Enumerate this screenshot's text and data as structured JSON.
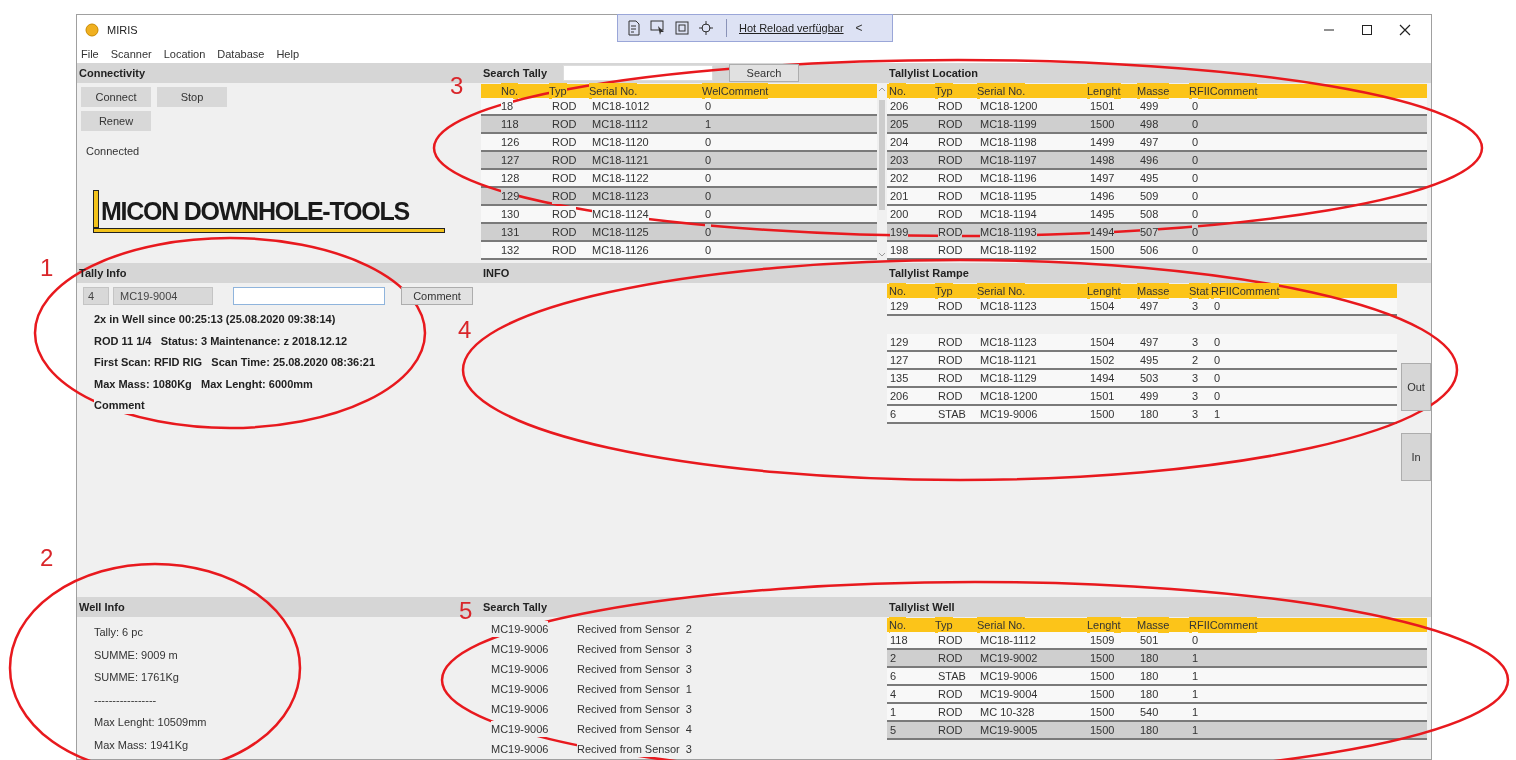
{
  "window": {
    "title": "MIRIS"
  },
  "debug_toolbar": {
    "label": "Hot Reload verfügbar",
    "collapse": "<"
  },
  "menu": [
    "File",
    "Scanner",
    "Location",
    "Database",
    "Help"
  ],
  "connectivity": {
    "title": "Connectivity",
    "buttons": [
      "Connect",
      "Stop",
      "Renew"
    ],
    "status": "Connected"
  },
  "logo": {
    "text": "MICON DOWNHOLE-TOOLS"
  },
  "search_tally": {
    "title": "Search Tally",
    "search_button": "Search",
    "columns": [
      "No.",
      "Typ",
      "Serial No.",
      "WelComment"
    ],
    "rows": [
      {
        "cells": [
          "18",
          "ROD",
          "MC18-1012",
          "0"
        ],
        "selected": false
      },
      {
        "cells": [
          "118",
          "ROD",
          "MC18-1112",
          "1"
        ],
        "selected": true
      },
      {
        "cells": [
          "126",
          "ROD",
          "MC18-1120",
          "0"
        ],
        "selected": false
      },
      {
        "cells": [
          "127",
          "ROD",
          "MC18-1121",
          "0"
        ],
        "selected": true
      },
      {
        "cells": [
          "128",
          "ROD",
          "MC18-1122",
          "0"
        ],
        "selected": false
      },
      {
        "cells": [
          "129",
          "ROD",
          "MC18-1123",
          "0"
        ],
        "selected": true
      },
      {
        "cells": [
          "130",
          "ROD",
          "MC18-1124",
          "0"
        ],
        "selected": false
      },
      {
        "cells": [
          "131",
          "ROD",
          "MC18-1125",
          "0"
        ],
        "selected": true
      },
      {
        "cells": [
          "132",
          "ROD",
          "MC18-1126",
          "0"
        ],
        "selected": false
      }
    ]
  },
  "tallylist_location": {
    "title": "Tallylist Location",
    "columns": [
      "No.",
      "Typ",
      "Serial No.",
      "Lenght",
      "Masse",
      "RFIIComment"
    ],
    "rows": [
      {
        "cells": [
          "206",
          "ROD",
          "MC18-1200",
          "1501",
          "499",
          "0"
        ],
        "selected": false
      },
      {
        "cells": [
          "205",
          "ROD",
          "MC18-1199",
          "1500",
          "498",
          "0"
        ],
        "selected": true
      },
      {
        "cells": [
          "204",
          "ROD",
          "MC18-1198",
          "1499",
          "497",
          "0"
        ],
        "selected": false
      },
      {
        "cells": [
          "203",
          "ROD",
          "MC18-1197",
          "1498",
          "496",
          "0"
        ],
        "selected": true
      },
      {
        "cells": [
          "202",
          "ROD",
          "MC18-1196",
          "1497",
          "495",
          "0"
        ],
        "selected": false
      },
      {
        "cells": [
          "201",
          "ROD",
          "MC18-1195",
          "1496",
          "509",
          "0"
        ],
        "selected": false
      },
      {
        "cells": [
          "200",
          "ROD",
          "MC18-1194",
          "1495",
          "508",
          "0"
        ],
        "selected": false
      },
      {
        "cells": [
          "199",
          "ROD",
          "MC18-1193",
          "1494",
          "507",
          "0"
        ],
        "selected": true
      },
      {
        "cells": [
          "198",
          "ROD",
          "MC18-1192",
          "1500",
          "506",
          "0"
        ],
        "selected": false
      }
    ]
  },
  "tally_info": {
    "title": "Tally Info",
    "number": "4",
    "serial": "MC19-9004",
    "comment_button": "Comment",
    "lines": [
      "2x in Well since 00:25:13 (25.08.2020 09:38:14)",
      "ROD 11 1/4   Status: 3 Maintenance: z 2018.12.12",
      "First Scan: RFID RIG   Scan Time: 25.08.2020 08:36:21",
      "Max Mass: 1080Kg   Max Lenght: 6000mm",
      "Comment"
    ]
  },
  "info": {
    "title": "INFO"
  },
  "tallylist_rampe": {
    "title": "Tallylist Rampe",
    "columns": [
      "No.",
      "Typ",
      "Serial No.",
      "Lenght",
      "Masse",
      "Stat",
      "RFIIComment"
    ],
    "rows": [
      {
        "kind": "data",
        "cells": [
          "129",
          "ROD",
          "MC18-1123",
          "1504",
          "497",
          "3",
          "0"
        ]
      },
      {
        "kind": "spacer"
      },
      {
        "kind": "data",
        "cells": [
          "129",
          "ROD",
          "MC18-1123",
          "1504",
          "497",
          "3",
          "0"
        ]
      },
      {
        "kind": "data",
        "cells": [
          "127",
          "ROD",
          "MC18-1121",
          "1502",
          "495",
          "2",
          "0"
        ]
      },
      {
        "kind": "data",
        "cells": [
          "135",
          "ROD",
          "MC18-1129",
          "1494",
          "503",
          "3",
          "0"
        ]
      },
      {
        "kind": "data",
        "cells": [
          "206",
          "ROD",
          "MC18-1200",
          "1501",
          "499",
          "3",
          "0"
        ]
      },
      {
        "kind": "data",
        "cells": [
          "6",
          "STAB",
          "MC19-9006",
          "1500",
          "180",
          "3",
          "1"
        ]
      }
    ],
    "buttons": [
      "Out",
      "In"
    ]
  },
  "well_info": {
    "title": "Well Info",
    "lines": [
      "Tally: 6 pc",
      "SUMME: 9009 m",
      "SUMME: 1761Kg",
      "-----------------",
      "Max Lenght: 10509mm",
      "Max Mass: 1941Kg"
    ]
  },
  "sensor_log": {
    "title": "Search Tally",
    "rows": [
      {
        "serial": "MC19-9006",
        "message": "Recived from Sensor  2"
      },
      {
        "serial": "MC19-9006",
        "message": "Recived from Sensor  3"
      },
      {
        "serial": "MC19-9006",
        "message": "Recived from Sensor  3"
      },
      {
        "serial": "MC19-9006",
        "message": "Recived from Sensor  1"
      },
      {
        "serial": "MC19-9006",
        "message": "Recived from Sensor  3"
      },
      {
        "serial": "MC19-9006",
        "message": "Recived from Sensor  4"
      },
      {
        "serial": "MC19-9006",
        "message": "Recived from Sensor  3"
      }
    ]
  },
  "tallylist_well": {
    "title": "Tallylist Well",
    "columns": [
      "No.",
      "Typ",
      "Serial No.",
      "Lenght",
      "Masse",
      "RFIIComment"
    ],
    "rows": [
      {
        "cells": [
          "118",
          "ROD",
          "MC18-1112",
          "1509",
          "501",
          "0"
        ],
        "selected": false
      },
      {
        "cells": [
          "2",
          "ROD",
          "MC19-9002",
          "1500",
          "180",
          "1"
        ],
        "selected": true
      },
      {
        "cells": [
          "6",
          "STAB",
          "MC19-9006",
          "1500",
          "180",
          "1"
        ],
        "selected": false
      },
      {
        "cells": [
          "4",
          "ROD",
          "MC19-9004",
          "1500",
          "180",
          "1"
        ],
        "selected": false
      },
      {
        "cells": [
          "1",
          "ROD",
          "MC 10-328",
          "1500",
          "540",
          "1"
        ],
        "selected": false
      },
      {
        "cells": [
          "5",
          "ROD",
          "MC19-9005",
          "1500",
          "180",
          "1"
        ],
        "selected": true
      }
    ]
  },
  "annotations": [
    {
      "label": "1"
    },
    {
      "label": "2"
    },
    {
      "label": "3"
    },
    {
      "label": "4"
    },
    {
      "label": "5"
    }
  ]
}
